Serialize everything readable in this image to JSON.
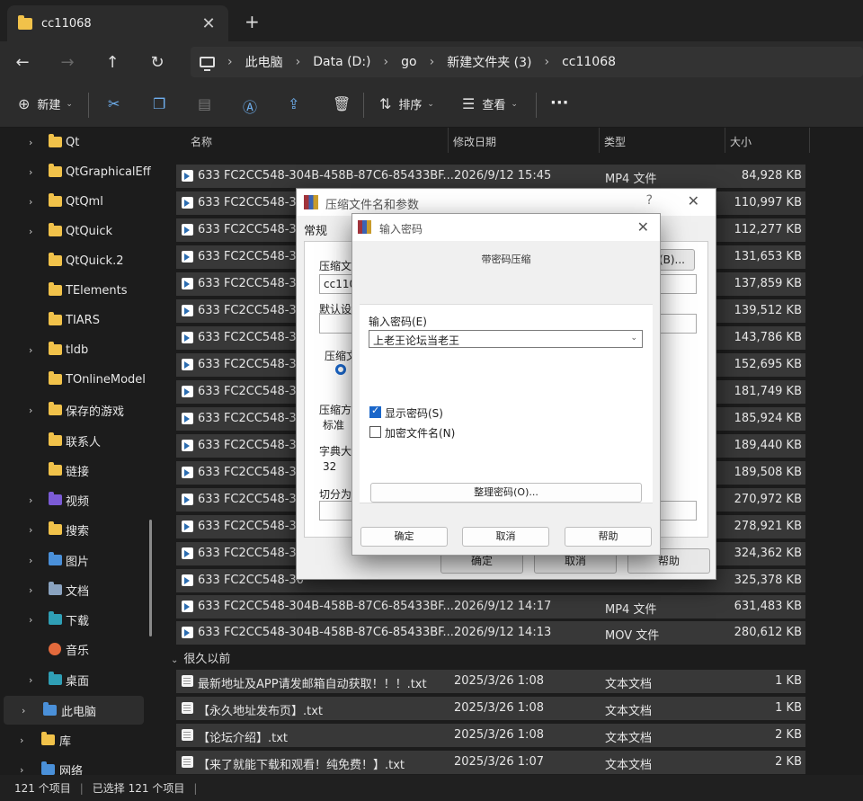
{
  "tab": {
    "title": "cc11068",
    "close": "✕",
    "new_tab": "+"
  },
  "nav": {
    "back": "←",
    "forward": "→",
    "up": "↑",
    "refresh": "↻"
  },
  "breadcrumb": [
    "此电脑",
    "Data (D:)",
    "go",
    "新建文件夹 (3)",
    "cc11068"
  ],
  "toolbar": {
    "new_label": "新建",
    "sort_label": "排序",
    "view_label": "查看",
    "more": "···"
  },
  "sidebar": {
    "items": [
      {
        "label": "Qt",
        "chev": "›",
        "icon": "folder"
      },
      {
        "label": "QtGraphicalEff",
        "chev": "›",
        "icon": "folder"
      },
      {
        "label": "QtQml",
        "chev": "›",
        "icon": "folder"
      },
      {
        "label": "QtQuick",
        "chev": "›",
        "icon": "folder"
      },
      {
        "label": "QtQuick.2",
        "chev": "",
        "icon": "folder"
      },
      {
        "label": "TElements",
        "chev": "",
        "icon": "folder"
      },
      {
        "label": "TIARS",
        "chev": "",
        "icon": "folder"
      },
      {
        "label": "tldb",
        "chev": "›",
        "icon": "folder"
      },
      {
        "label": "TOnlineModel",
        "chev": "",
        "icon": "folder"
      },
      {
        "label": "保存的游戏",
        "chev": "›",
        "icon": "folder"
      },
      {
        "label": "联系人",
        "chev": "",
        "icon": "folder"
      },
      {
        "label": "链接",
        "chev": "",
        "icon": "folder"
      },
      {
        "label": "视频",
        "chev": "›",
        "icon": "video"
      },
      {
        "label": "搜索",
        "chev": "›",
        "icon": "folder"
      },
      {
        "label": "图片",
        "chev": "›",
        "icon": "pictures"
      },
      {
        "label": "文档",
        "chev": "›",
        "icon": "documents"
      },
      {
        "label": "下载",
        "chev": "›",
        "icon": "downloads"
      },
      {
        "label": "音乐",
        "chev": "",
        "icon": "music"
      },
      {
        "label": "桌面",
        "chev": "›",
        "icon": "desktop"
      },
      {
        "label": "此电脑",
        "chev": "›",
        "icon": "pc"
      },
      {
        "label": "库",
        "chev": "›",
        "icon": "folder"
      },
      {
        "label": "网络",
        "chev": "›",
        "icon": "network"
      }
    ]
  },
  "columns": {
    "name": "名称",
    "date": "修改日期",
    "type": "类型",
    "size": "大小"
  },
  "files": [
    {
      "name": "633 FC2CC548-304B-458B-87C6-85433BF...",
      "date": "2026/9/12 15:45",
      "type": "MP4 文件",
      "size": "84,928 KB"
    },
    {
      "name": "633 FC2CC548-30",
      "date": "",
      "type": "",
      "size": "110,997 KB"
    },
    {
      "name": "633 FC2CC548-30",
      "date": "",
      "type": "",
      "size": "112,277 KB"
    },
    {
      "name": "633 FC2CC548-30",
      "date": "",
      "type": "",
      "size": "131,653 KB"
    },
    {
      "name": "633 FC2CC548-30",
      "date": "",
      "type": "",
      "size": "137,859 KB"
    },
    {
      "name": "633 FC2CC548-30",
      "date": "",
      "type": "",
      "size": "139,512 KB"
    },
    {
      "name": "633 FC2CC548-30",
      "date": "",
      "type": "",
      "size": "143,786 KB"
    },
    {
      "name": "633 FC2CC548-30",
      "date": "",
      "type": "",
      "size": "152,695 KB"
    },
    {
      "name": "633 FC2CC548-30",
      "date": "",
      "type": "",
      "size": "181,749 KB"
    },
    {
      "name": "633 FC2CC548-30",
      "date": "",
      "type": "",
      "size": "185,924 KB"
    },
    {
      "name": "633 FC2CC548-30",
      "date": "",
      "type": "",
      "size": "189,440 KB"
    },
    {
      "name": "633 FC2CC548-30",
      "date": "",
      "type": "",
      "size": "189,508 KB"
    },
    {
      "name": "633 FC2CC548-30",
      "date": "",
      "type": "",
      "size": "270,972 KB"
    },
    {
      "name": "633 FC2CC548-30",
      "date": "",
      "type": "",
      "size": "278,921 KB"
    },
    {
      "name": "633 FC2CC548-30",
      "date": "",
      "type": "",
      "size": "324,362 KB"
    },
    {
      "name": "633 FC2CC548-30",
      "date": "",
      "type": "",
      "size": "325,378 KB"
    },
    {
      "name": "633 FC2CC548-304B-458B-87C6-85433BF...",
      "date": "2026/9/12 14:17",
      "type": "MP4 文件",
      "size": "631,483 KB"
    },
    {
      "name": "633 FC2CC548-304B-458B-87C6-85433BF...",
      "date": "2026/9/12 14:13",
      "type": "MOV 文件",
      "size": "280,612 KB"
    }
  ],
  "group_label": "很久以前",
  "txt_files": [
    {
      "name": "最新地址及APP请发邮箱自动获取！！！.txt",
      "date": "2025/3/26 1:08",
      "type": "文本文档",
      "size": "1 KB"
    },
    {
      "name": "【永久地址发布页】.txt",
      "date": "2025/3/26 1:08",
      "type": "文本文档",
      "size": "1 KB"
    },
    {
      "name": "【论坛介绍】.txt",
      "date": "2025/3/26 1:08",
      "type": "文本文档",
      "size": "2 KB"
    },
    {
      "name": "【来了就能下载和观看！纯免费！】.txt",
      "date": "2025/3/26 1:07",
      "type": "文本文档",
      "size": "2 KB"
    }
  ],
  "status": {
    "count": "121 个项目",
    "selected": "已选择 121 个项目"
  },
  "archive_dialog": {
    "title": "压缩文件名和参数",
    "help_glyph": "?",
    "close": "✕",
    "tab_general": "常规",
    "label_archive_name": "压缩文",
    "archive_name_value": "cc1106",
    "browse_button": "(B)...",
    "label_default": "默认设",
    "label_format": "压缩文",
    "label_method": "压缩方",
    "method_value": "标准",
    "label_dict": "字典大",
    "dict_value": "32",
    "label_split": "切分为",
    "ok": "确定",
    "cancel": "取消",
    "help": "帮助"
  },
  "password_dialog": {
    "title": "输入密码",
    "close": "✕",
    "heading": "带密码压缩",
    "password_label": "输入密码(E)",
    "password_value": "上老王论坛当老王",
    "show_password": "显示密码(S)",
    "encrypt_names": "加密文件名(N)",
    "organize_button": "整理密码(O)...",
    "ok": "确定",
    "cancel": "取消",
    "help": "帮助"
  }
}
